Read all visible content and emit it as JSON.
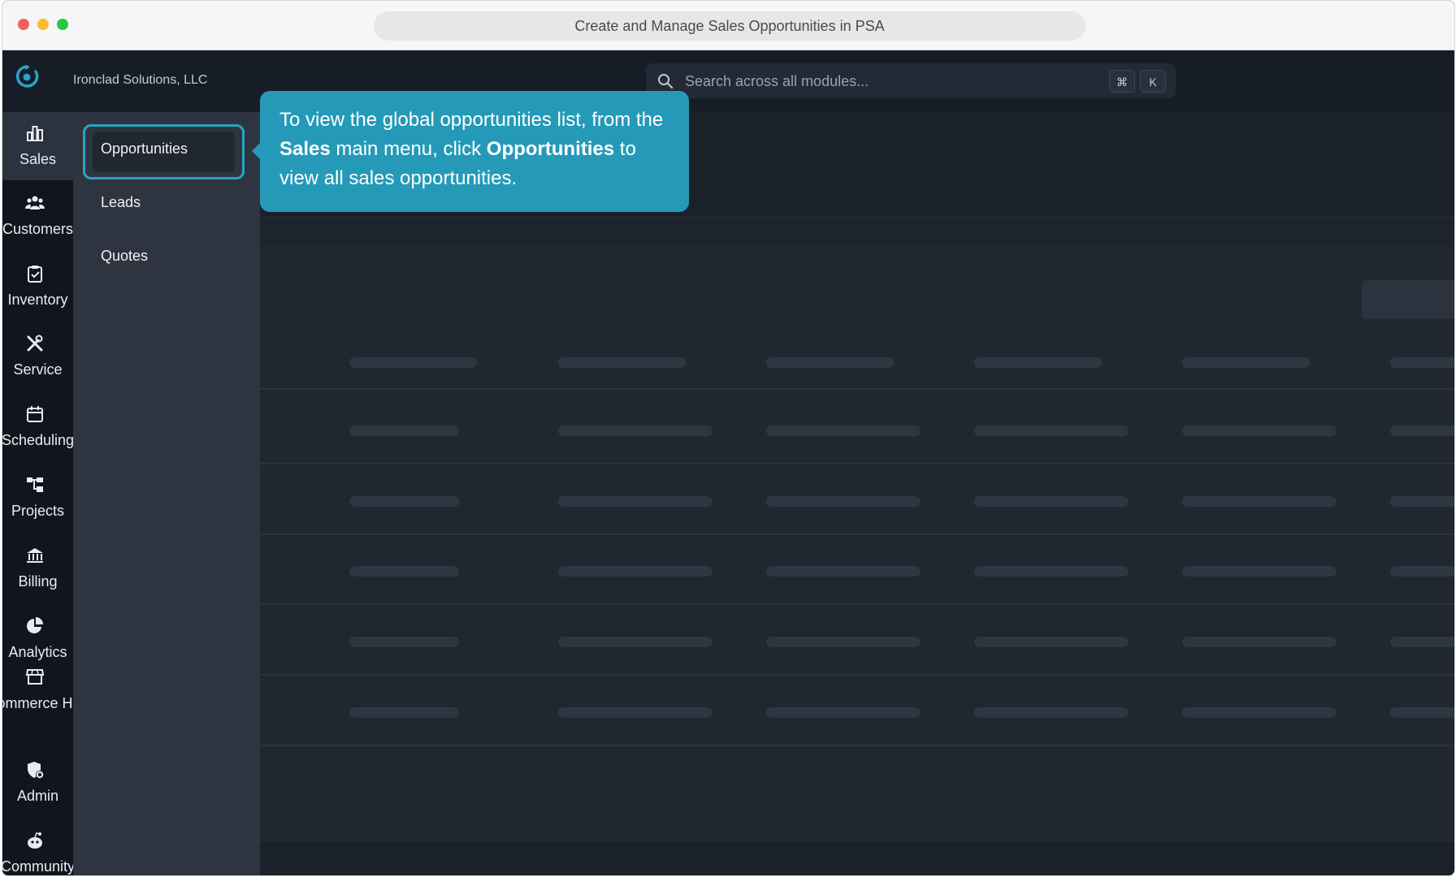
{
  "window": {
    "title": "Create and Manage Sales Opportunities in PSA"
  },
  "topbar": {
    "org_name": "Ironclad Solutions, LLC",
    "search": {
      "placeholder": "Search across all modules...",
      "shortcut_keys": [
        "⌘",
        "K"
      ]
    }
  },
  "rail": {
    "items": [
      {
        "label": "Sales",
        "icon": "chart-bar-icon",
        "active": true
      },
      {
        "label": "Customers",
        "icon": "users-icon"
      },
      {
        "label": "Inventory",
        "icon": "clipboard-check-icon"
      },
      {
        "label": "Service",
        "icon": "tools-icon"
      },
      {
        "label": "Scheduling",
        "icon": "calendar-icon"
      },
      {
        "label": "Projects",
        "icon": "hierarchy-icon"
      },
      {
        "label": "Billing",
        "icon": "bank-icon"
      },
      {
        "label": "Analytics",
        "icon": "pie-chart-icon"
      },
      {
        "label": "Commerce Hub",
        "icon": "storefront-icon"
      },
      {
        "label": "Admin",
        "icon": "shield-gear-icon"
      },
      {
        "label": "Community",
        "icon": "community-icon"
      }
    ]
  },
  "submenu": {
    "items": [
      {
        "label": "Opportunities",
        "active": true
      },
      {
        "label": "Leads"
      },
      {
        "label": "Quotes"
      }
    ]
  },
  "tooltip": {
    "part1": "To view the global opportunities list, from the ",
    "bold1": "Sales",
    "part2": " main menu, click ",
    "bold2": "Opportunities",
    "part3": " to view all sales opportunities."
  },
  "colors": {
    "accent": "#259ab8",
    "highlight_border": "#2aa3c4",
    "rail_bg": "#11161e",
    "submenu_bg": "#2e3540"
  }
}
